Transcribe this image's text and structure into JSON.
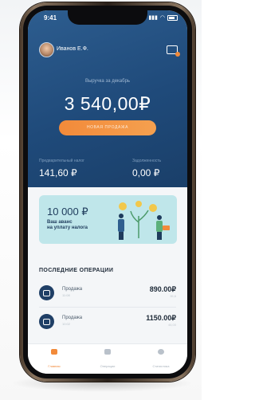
{
  "status_bar": {
    "time": "9:41"
  },
  "header": {
    "user_name": "Иванов Е.Ф."
  },
  "summary": {
    "revenue_label": "Выручка за декабрь",
    "revenue_amount": "3 540,00₽",
    "new_sale_label": "Новая продажа",
    "tax_label": "Предварительный налог",
    "tax_value": "141,60 ₽",
    "debt_label": "Задолженность",
    "debt_value": "0,00 ₽"
  },
  "promo": {
    "amount": "10 000 ₽",
    "text_line1": "Ваш аванс",
    "text_line2": "на уплату налога"
  },
  "operations": {
    "title": "ПОСЛЕДНИЕ ОПЕРАЦИИ",
    "items": [
      {
        "label": "Продажа",
        "time": "11:08",
        "amount": "890.00₽",
        "sub": "35,6"
      },
      {
        "label": "Продажа",
        "time": "10:02",
        "amount": "1150.00₽",
        "sub": "46,00"
      }
    ]
  },
  "tabbar": {
    "items": [
      {
        "label": "Главная",
        "icon": "wallet-icon",
        "active": true
      },
      {
        "label": "Операции",
        "icon": "receipt-icon",
        "active": false
      },
      {
        "label": "Статистика",
        "icon": "pie-chart-icon",
        "active": false
      }
    ]
  },
  "colors": {
    "hero": "#1f4a7a",
    "accent": "#f28a3a",
    "promo_bg": "#bfe6ea"
  }
}
